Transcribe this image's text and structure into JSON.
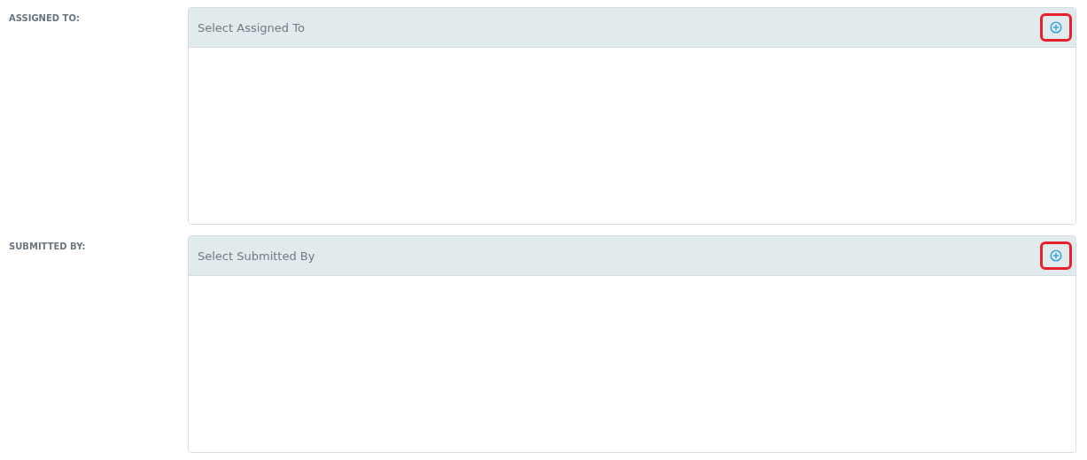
{
  "fields": [
    {
      "label": "ASSIGNED TO:",
      "header": "Select Assigned To",
      "highlighted": true
    },
    {
      "label": "SUBMITTED BY:",
      "header": "Select Submitted By",
      "highlighted": true
    }
  ]
}
